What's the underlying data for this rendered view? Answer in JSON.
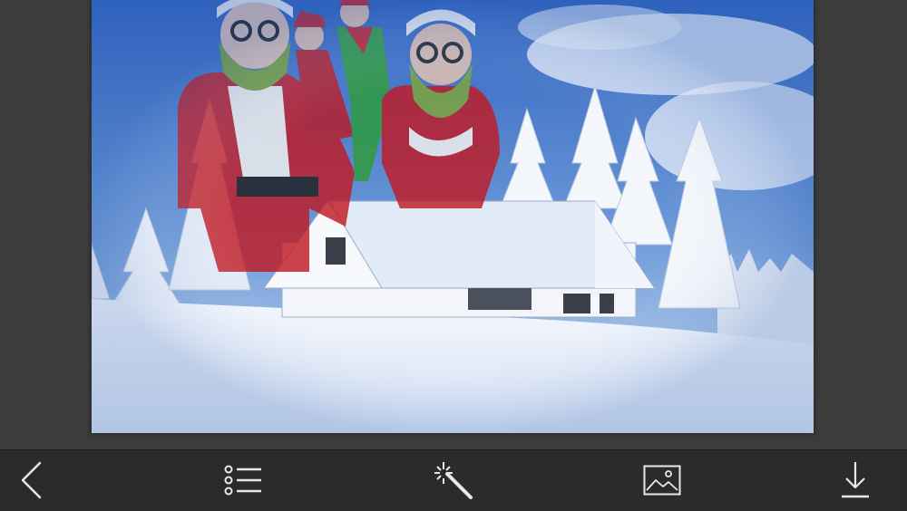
{
  "editor": {
    "photo": {
      "description_name": "santa-grinch-runners-over-snowy-cabin"
    }
  },
  "toolbar": {
    "items": [
      {
        "icon": "chevron-left-icon",
        "name": "back-button"
      },
      {
        "icon": "list-icon",
        "name": "menu-list-button"
      },
      {
        "icon": "magic-wand-icon",
        "name": "effects-button"
      },
      {
        "icon": "image-icon",
        "name": "background-image-button"
      },
      {
        "icon": "download-icon",
        "name": "download-button"
      }
    ],
    "icon_color": "#e8e8e8"
  },
  "colors": {
    "page_background": "#3c3c3c",
    "toolbar_background": "#2b2b2b",
    "sky_top": "#3a6fc8",
    "sky_bottom": "#a9c8ea",
    "snow": "#eef3fb"
  }
}
